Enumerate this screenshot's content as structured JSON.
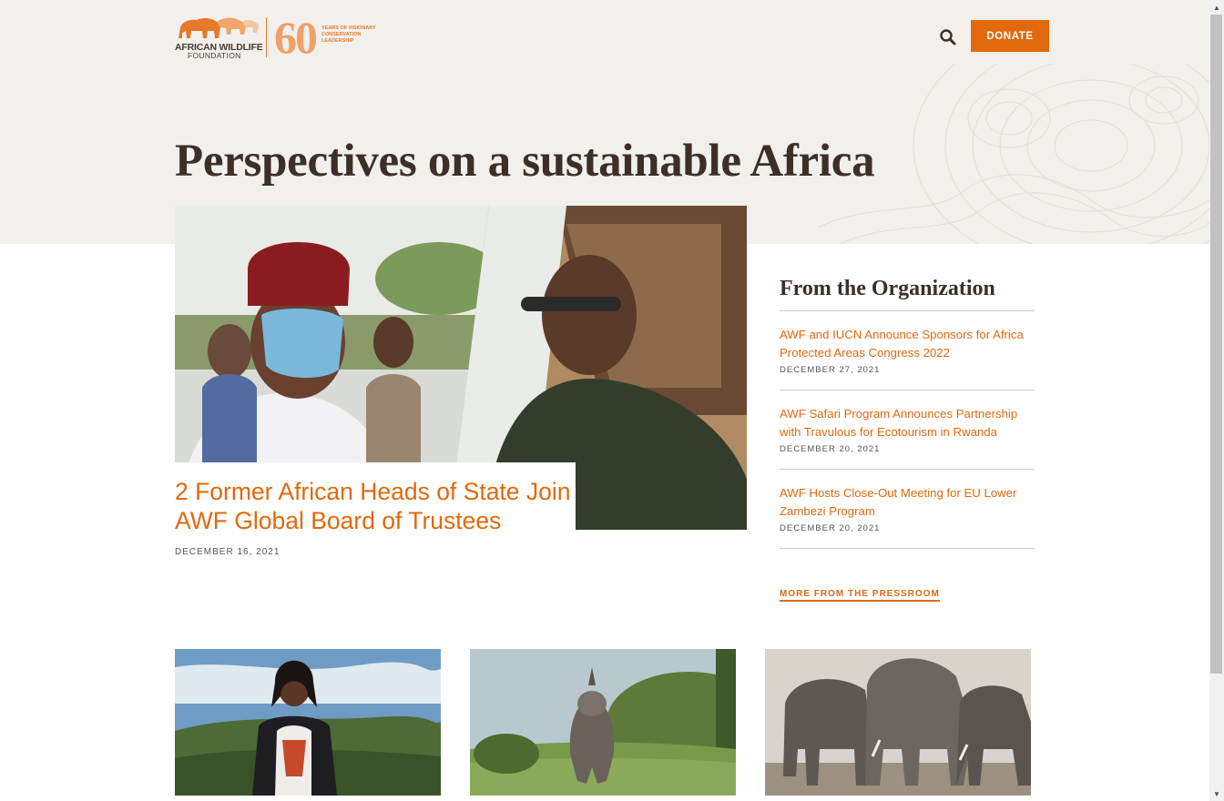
{
  "header": {
    "logo_line1": "AFRICAN WILDLIFE",
    "logo_line2": "FOUNDATION",
    "logo_sixty": "60",
    "logo_tag": "YEARS OF VISIONARY CONSERVATION LEADERSHIP",
    "search_icon": "search-icon",
    "donate_label": "DONATE"
  },
  "page_title": "Perspectives on a sustainable Africa",
  "feature": {
    "title": "2 Former African Heads of State Join AWF Global Board of Trustees",
    "date": "DECEMBER 16, 2021"
  },
  "sidebar": {
    "heading": "From the Organization",
    "items": [
      {
        "title": "AWF and IUCN Announce Sponsors for Africa Protected Areas Congress 2022",
        "date": "DECEMBER 27, 2021"
      },
      {
        "title": "AWF Safari Program Announces Partnership with Travulous for Ecotourism in Rwanda",
        "date": "DECEMBER 20, 2021"
      },
      {
        "title": "AWF Hosts Close-Out Meeting for EU Lower Zambezi Program",
        "date": "DECEMBER 20, 2021"
      }
    ],
    "more_label": "MORE FROM THE PRESSROOM"
  },
  "colors": {
    "accent": "#e1690e",
    "heading": "#3d2f28",
    "hero_bg": "#f1f0ed"
  }
}
